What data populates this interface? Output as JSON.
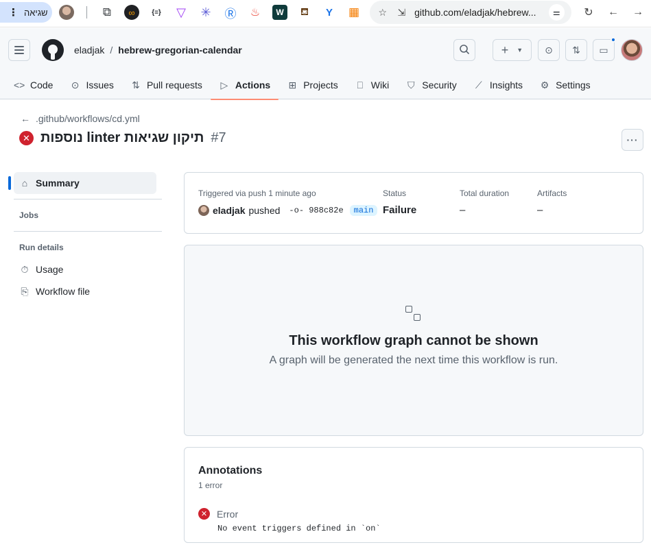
{
  "browser": {
    "profile_label": "שגיאה",
    "url": "github.com/eladjak/hebrew...",
    "extensions": [
      {
        "name": "puzzle-icon",
        "glyph": "⧉",
        "color": "#3c4043"
      },
      {
        "name": "infinity-icon",
        "glyph": "∞",
        "color": "#f29900"
      },
      {
        "name": "braces-icon",
        "glyph": "{≡}",
        "color": "#202124"
      },
      {
        "name": "funnel-icon",
        "glyph": "▽",
        "color": "#a142f4"
      },
      {
        "name": "asterisk-icon",
        "glyph": "✳",
        "color": "#5b5bd6"
      },
      {
        "name": "r-icon",
        "glyph": "Ⓡ",
        "color": "#1a73e8"
      },
      {
        "name": "flame-icon",
        "glyph": "♨",
        "color": "#ea4335"
      },
      {
        "name": "w-icon",
        "glyph": "W",
        "color": "#ffffff"
      },
      {
        "name": "pot-icon",
        "glyph": "⛾",
        "color": "#5f370e"
      },
      {
        "name": "y-icon",
        "glyph": "Y",
        "color": "#1a73e8"
      },
      {
        "name": "layout-icon",
        "glyph": "▦",
        "color": "#f57c00"
      }
    ]
  },
  "header": {
    "owner": "eladjak",
    "separator": "/",
    "repo": "hebrew-gregorian-calendar"
  },
  "repo_nav": [
    {
      "label": "Code",
      "icon": "code-icon",
      "glyph": "<>"
    },
    {
      "label": "Issues",
      "icon": "issue-icon",
      "glyph": "⊙"
    },
    {
      "label": "Pull requests",
      "icon": "pull-request-icon",
      "glyph": "⇅"
    },
    {
      "label": "Actions",
      "icon": "play-icon",
      "glyph": "▷",
      "active": true
    },
    {
      "label": "Projects",
      "icon": "table-icon",
      "glyph": "⊞"
    },
    {
      "label": "Wiki",
      "icon": "book-icon",
      "glyph": "📖"
    },
    {
      "label": "Security",
      "icon": "shield-icon",
      "glyph": "⛉"
    },
    {
      "label": "Insights",
      "icon": "graph-icon",
      "glyph": "⟋"
    },
    {
      "label": "Settings",
      "icon": "gear-icon",
      "glyph": "⚙"
    }
  ],
  "run": {
    "back_link": ".github/workflows/cd.yml",
    "title": "תיקון שגיאות linter נוספות",
    "number": "#7"
  },
  "sidebar": {
    "summary": "Summary",
    "jobs_heading": "Jobs",
    "run_details_heading": "Run details",
    "usage": "Usage",
    "workflow_file": "Workflow file"
  },
  "summary": {
    "triggered": "Triggered via push 1 minute ago",
    "actor": "eladjak",
    "action": "pushed",
    "commit": "988c82e",
    "branch": "main",
    "status_label": "Status",
    "status_value": "Failure",
    "duration_label": "Total duration",
    "duration_value": "–",
    "artifacts_label": "Artifacts",
    "artifacts_value": "–"
  },
  "graph": {
    "title": "This workflow graph cannot be shown",
    "subtitle": "A graph will be generated the next time this workflow is run."
  },
  "annotations": {
    "title": "Annotations",
    "count": "1 error",
    "items": [
      {
        "level": "Error",
        "message": "No event triggers defined in `on`"
      }
    ]
  },
  "colors": {
    "accent": "#0969da",
    "danger": "#cf222e",
    "active_tab_underline": "#fd8c73"
  }
}
